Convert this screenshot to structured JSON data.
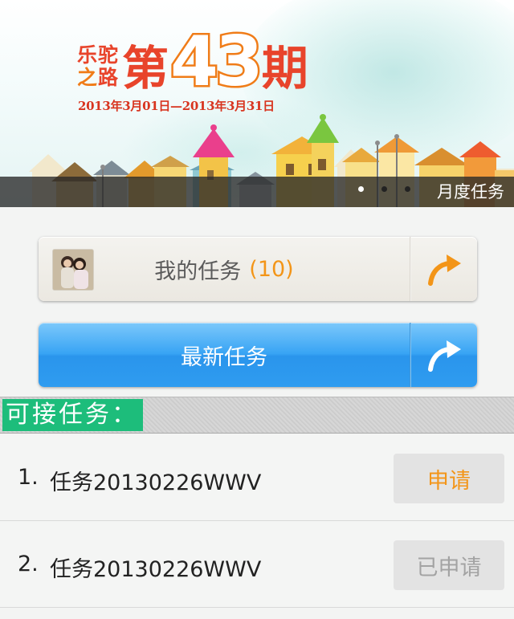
{
  "banner": {
    "brand_chars": [
      "乐",
      "驼",
      "之",
      "路"
    ],
    "issue_prefix": "第",
    "issue_number": "43",
    "issue_suffix": "期",
    "date_range": "2013年3月01日—2013年3月31日",
    "caption": "月度任务",
    "carousel": {
      "total": 3,
      "active_index": 0
    }
  },
  "my_tasks": {
    "label": "我的任务",
    "count": "(10)",
    "arrow_icon": "curved-arrow-icon",
    "avatar": "user-avatar"
  },
  "new_tasks": {
    "label": "最新任务",
    "arrow_icon": "curved-arrow-icon"
  },
  "section": {
    "title": "可接任务："
  },
  "tasks": [
    {
      "index": "1.",
      "name": "任务20130226WWV",
      "action": "申请",
      "state": "apply"
    },
    {
      "index": "2.",
      "name": "任务20130226WWV",
      "action": "已申请",
      "state": "applied"
    }
  ],
  "colors": {
    "accent_orange": "#f39518",
    "primary_blue": "#2f9cf0",
    "section_green": "#1dbd7b",
    "brand_red": "#e8442b"
  }
}
